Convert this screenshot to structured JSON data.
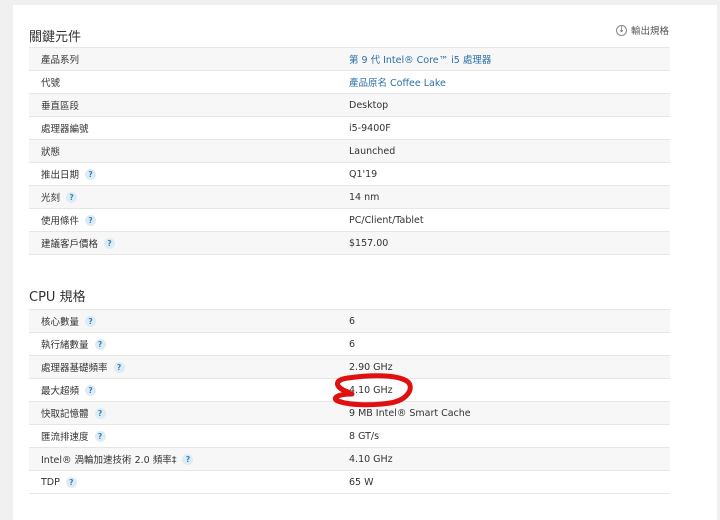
{
  "key_elements": {
    "title": "關鍵元件",
    "export_label": "輸出規格",
    "rows": [
      {
        "label": "產品系列",
        "value": "第 9 代 Intel® Core™ i5 處理器",
        "help": false,
        "link": true
      },
      {
        "label": "代號",
        "value": "產品原名 Coffee Lake",
        "help": false,
        "link": true
      },
      {
        "label": "垂直區段",
        "value": "Desktop",
        "help": false,
        "link": false
      },
      {
        "label": "處理器編號",
        "value": "i5-9400F",
        "help": false,
        "link": false
      },
      {
        "label": "狀態",
        "value": "Launched",
        "help": false,
        "link": false
      },
      {
        "label": "推出日期",
        "value": "Q1'19",
        "help": true,
        "link": false
      },
      {
        "label": "光刻",
        "value": "14 nm",
        "help": true,
        "link": false
      },
      {
        "label": "使用條件",
        "value": "PC/Client/Tablet",
        "help": true,
        "link": false
      },
      {
        "label": "建議客戶價格",
        "value": "$157.00",
        "help": true,
        "link": false
      }
    ]
  },
  "cpu_specs": {
    "title": "CPU 規格",
    "rows": [
      {
        "label": "核心數量",
        "value": "6",
        "help": true,
        "link": false
      },
      {
        "label": "執行緒數量",
        "value": "6",
        "help": true,
        "link": false
      },
      {
        "label": "處理器基礎頻率",
        "value": "2.90 GHz",
        "help": true,
        "link": false
      },
      {
        "label": "最大超頻",
        "value": "4.10 GHz",
        "help": true,
        "link": false
      },
      {
        "label": "快取記憶體",
        "value": "9 MB Intel® Smart Cache",
        "help": true,
        "link": false
      },
      {
        "label": "匯流排速度",
        "value": "8 GT/s",
        "help": true,
        "link": false
      },
      {
        "label": "Intel® 渦輪加速技術 2.0 頻率‡",
        "value": "4.10 GHz",
        "help": true,
        "link": false
      },
      {
        "label": "TDP",
        "value": "65 W",
        "help": true,
        "link": false
      }
    ]
  },
  "help_glyph": "?",
  "export_icon_glyph": "↓",
  "colors": {
    "link": "#2a6fa8",
    "help_bg": "#dcecf5",
    "annotation": "#e01010"
  }
}
